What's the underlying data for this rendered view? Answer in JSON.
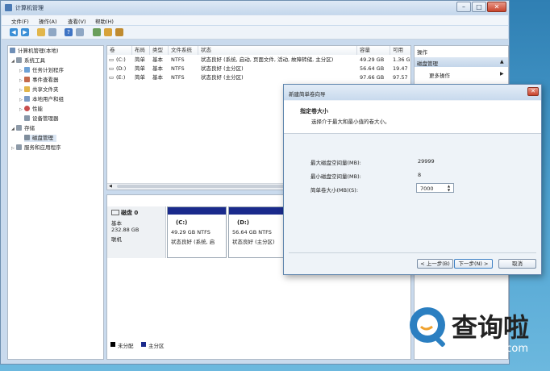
{
  "window": {
    "title": "计算机管理",
    "controls": [
      "–",
      "□",
      "✕"
    ]
  },
  "menu": [
    "文件(F)",
    "操作(A)",
    "查看(V)",
    "帮助(H)"
  ],
  "tree": [
    {
      "label": "计算机管理(本地)",
      "level": 0
    },
    {
      "label": "系统工具",
      "level": 1
    },
    {
      "label": "任务计划程序",
      "level": 2
    },
    {
      "label": "事件查看器",
      "level": 2
    },
    {
      "label": "共享文件夹",
      "level": 2
    },
    {
      "label": "本地用户和组",
      "level": 2
    },
    {
      "label": "性能",
      "level": 2
    },
    {
      "label": "设备管理器",
      "level": 2
    },
    {
      "label": "存储",
      "level": 1
    },
    {
      "label": "磁盘管理",
      "level": 2
    },
    {
      "label": "服务和应用程序",
      "level": 1
    }
  ],
  "volumes": {
    "headers": [
      "卷",
      "布局",
      "类型",
      "文件系统",
      "状态",
      "容量",
      "可用"
    ],
    "rows": [
      [
        "(C:)",
        "简单",
        "基本",
        "NTFS",
        "状态良好 (系统, 启动, 页面文件, 活动, 故障转储, 主分区)",
        "49.29 GB",
        "1.36 G"
      ],
      [
        "(D:)",
        "简单",
        "基本",
        "NTFS",
        "状态良好 (主分区)",
        "56.64 GB",
        "19.47"
      ],
      [
        "(E:)",
        "简单",
        "基本",
        "NTFS",
        "状态良好 (主分区)",
        "97.66 GB",
        "97.57"
      ]
    ]
  },
  "disk": {
    "name": "磁盘 0",
    "type": "基本",
    "size": "232.88 GB",
    "status": "联机",
    "partitions": [
      {
        "label": "(C:)",
        "size": "49.29 GB NTFS",
        "status": "状态良好 (系统, 启"
      },
      {
        "label": "(D:)",
        "size": "56.64 GB NTFS",
        "status": "状态良好 (主分区)"
      }
    ]
  },
  "legend": [
    {
      "label": "未分配",
      "color": "#000000"
    },
    {
      "label": "主分区",
      "color": "#1a2a8c"
    }
  ],
  "actions": {
    "header": "操作",
    "section": "磁盘管理",
    "more": "更多操作"
  },
  "dialog": {
    "title": "新建简单卷向导",
    "heading": "指定卷大小",
    "subheading": "选择介于最大和最小值的卷大小。",
    "max_label": "最大磁盘空间量(MB):",
    "max_value": "29999",
    "min_label": "最小磁盘空间量(MB):",
    "min_value": "8",
    "size_label": "简单卷大小(MB)(S):",
    "size_value": "7000",
    "back": "< 上一步(B)",
    "next": "下一步(N) >",
    "cancel": "取消"
  },
  "watermark": {
    "brand": "查询啦",
    "url": "chaxunla.com"
  },
  "colors": {
    "primary_partition": "#1a2a8c",
    "window_frame": "#c9daed",
    "accent": "#2b7fc1"
  }
}
